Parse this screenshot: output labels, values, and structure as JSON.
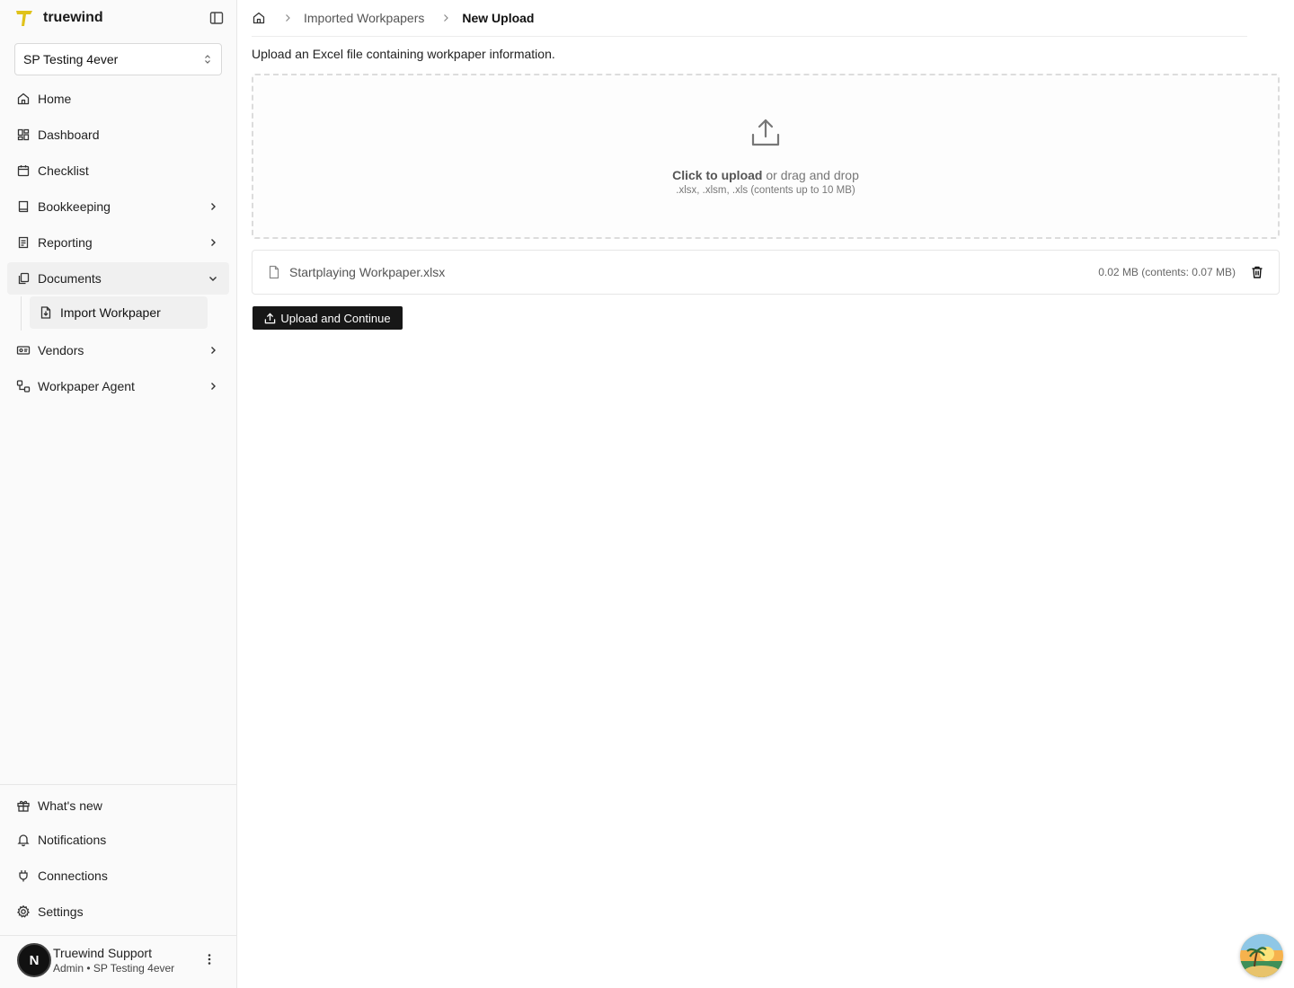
{
  "brand": {
    "name": "truewind",
    "logo_color": "#e0c21a"
  },
  "org_select": {
    "value": "SP Testing 4ever"
  },
  "nav": {
    "home": "Home",
    "dashboard": "Dashboard",
    "checklist": "Checklist",
    "bookkeeping": "Bookkeeping",
    "reporting": "Reporting",
    "documents": "Documents",
    "import_workpaper": "Import Workpaper",
    "vendors": "Vendors",
    "workpaper_agent": "Workpaper Agent"
  },
  "bottom_nav": {
    "whats_new": "What's new",
    "notifications": "Notifications",
    "connections": "Connections",
    "settings": "Settings"
  },
  "user": {
    "initial": "N",
    "name": "Truewind Support",
    "role": "Admin • SP Testing 4ever"
  },
  "breadcrumb": {
    "parent": "Imported Workpapers",
    "current": "New Upload"
  },
  "main": {
    "intro": "Upload an Excel file containing workpaper information.",
    "dropzone": {
      "cta": "Click to upload",
      "cta_rest": " or drag and drop",
      "hint": ".xlsx, .xlsm, .xls (contents up to 10 MB)"
    },
    "file": {
      "name": "Startplaying Workpaper.xlsx",
      "size": "0.02 MB (contents: 0.07 MB)"
    },
    "upload_button": "Upload and Continue"
  },
  "icons": {
    "home": "home-icon",
    "dashboard": "grid-icon",
    "checklist": "calendar-icon",
    "bookkeeping": "book-icon",
    "reporting": "report-icon",
    "documents": "copy-icon",
    "vendors": "id-card-icon",
    "workpaper_agent": "workflow-icon",
    "upload": "upload-icon",
    "file": "file-icon",
    "trash": "trash-icon"
  }
}
